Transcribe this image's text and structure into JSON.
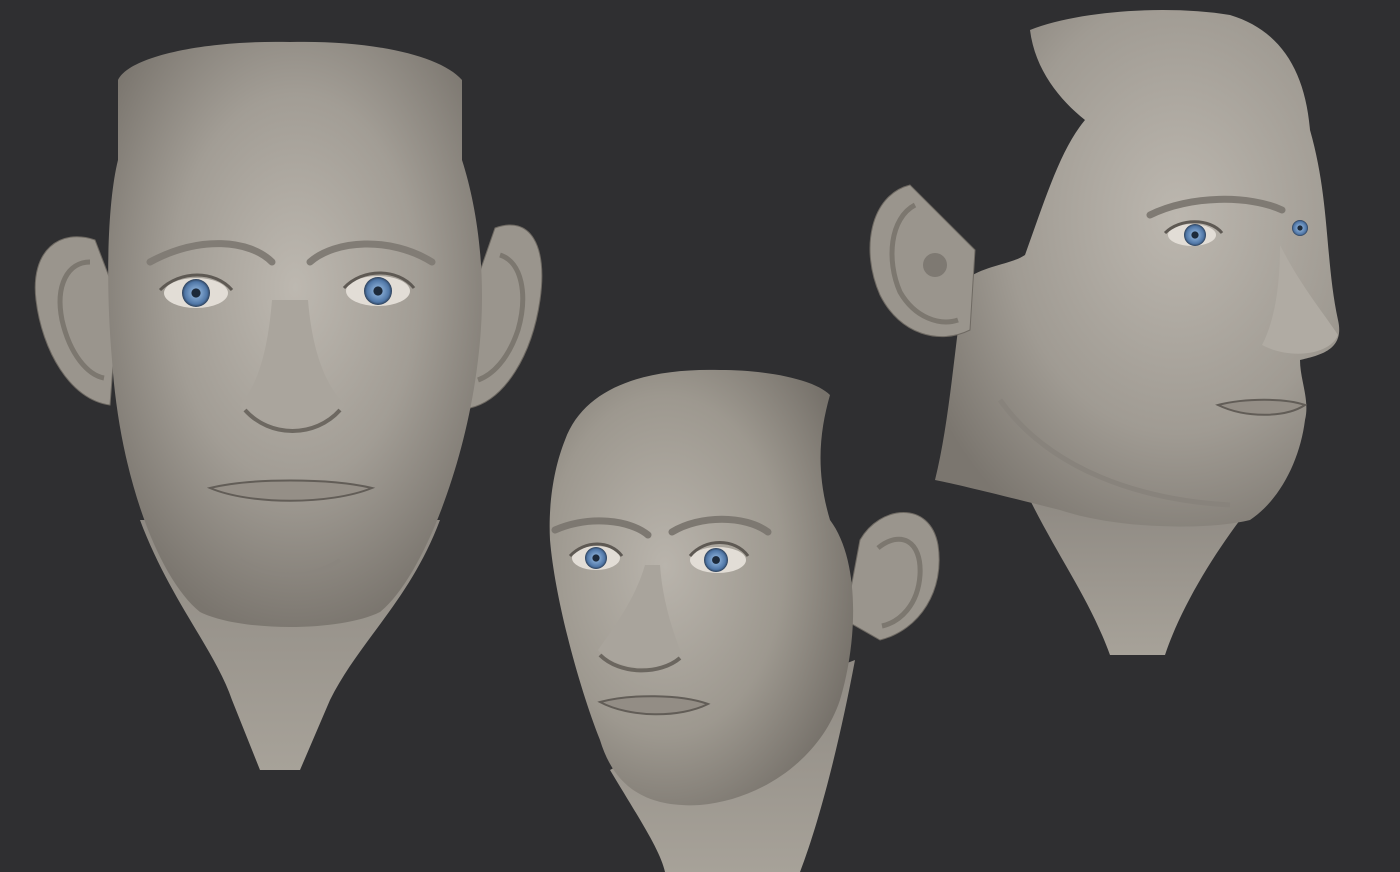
{
  "scene": {
    "background_color": "#2f2f31",
    "subject": "sculpted-head",
    "material_color": "#a39e96",
    "iris_color": "#5f86b4",
    "views": [
      {
        "name": "front"
      },
      {
        "name": "three-quarter"
      },
      {
        "name": "profile"
      }
    ]
  }
}
